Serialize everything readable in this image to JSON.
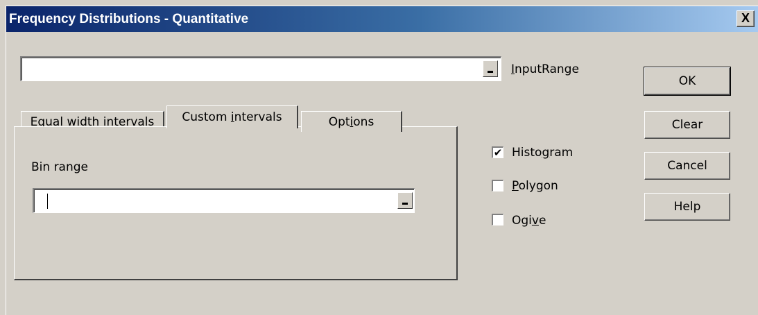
{
  "window": {
    "title": "Frequency Distributions - Quantitative",
    "close_label": "X"
  },
  "input_range": {
    "value": "",
    "label_prefix": "",
    "label_mnemonic": "I",
    "label_rest": "nputRange"
  },
  "tabs": [
    {
      "mnemonic": "E",
      "rest": "qual width intervals",
      "pre": "",
      "active": false
    },
    {
      "pre": "Custom ",
      "mnemonic": "i",
      "rest": "ntervals",
      "active": true
    },
    {
      "pre": "Opt",
      "mnemonic": "i",
      "rest": "ons",
      "active": false
    }
  ],
  "custom_tab": {
    "bin_range_label": "Bin range",
    "bin_range_value": ""
  },
  "options": {
    "histogram": {
      "pre": "Histo",
      "mnemonic": "g",
      "rest": "ram",
      "checked": true
    },
    "polygon": {
      "pre": "",
      "mnemonic": "P",
      "rest": "olygon",
      "checked": false
    },
    "ogive": {
      "pre": "Ogi",
      "mnemonic": "v",
      "rest": "e",
      "checked": false
    }
  },
  "buttons": {
    "ok": "OK",
    "clear": "Clear",
    "cancel": "Cancel",
    "help": "Help"
  },
  "check_mark": "✔"
}
